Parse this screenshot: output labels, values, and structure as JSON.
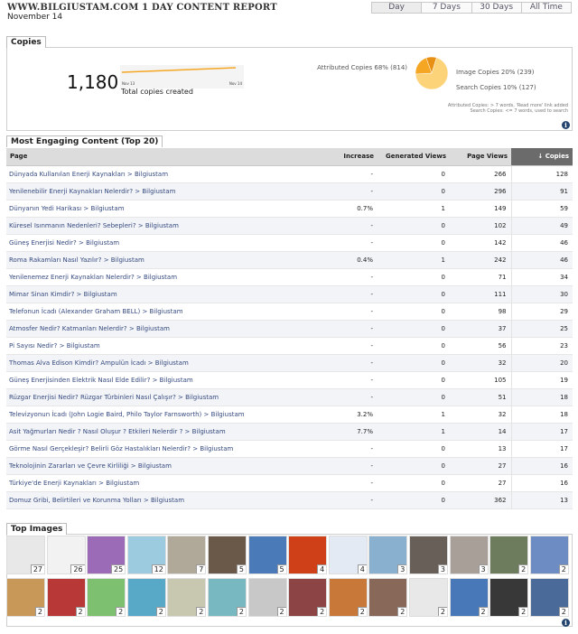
{
  "header": {
    "title": "WWW.BILGIUSTAM.COM 1 DAY CONTENT REPORT",
    "date": "November 14"
  },
  "range_tabs": [
    "Day",
    "7 Days",
    "30 Days",
    "All Time"
  ],
  "copies": {
    "section_label": "Copies",
    "total": "1,180",
    "total_label": "Total copies created",
    "spark_start": "Nov 13",
    "spark_end": "Nov 14",
    "pie": {
      "attributed_label": "Attributed Copies 68% (814)",
      "image_label": "Image Copies 20% (239)",
      "search_label": "Search Copies 10% (127)",
      "slices": [
        {
          "name": "Attributed Copies",
          "percent": 68,
          "color": "#fdd37a"
        },
        {
          "name": "Image Copies",
          "percent": 20,
          "color": "#f5a623"
        },
        {
          "name": "Search Copies",
          "percent": 10,
          "color": "#e89014"
        }
      ]
    },
    "note_line1": "Attributed Copies: > 7 words, 'Read more' link added",
    "note_line2": "Search Copies: <= 7 words, used to search"
  },
  "engaging": {
    "section_label": "Most Engaging Content (Top 20)",
    "columns": {
      "page": "Page",
      "increase": "Increase",
      "generated": "Generated Views",
      "views": "Page Views",
      "copies": "↓ Copies"
    },
    "rows": [
      {
        "page": "Dünyada Kullanılan Enerji Kaynakları > Bilgiustam",
        "increase": "-",
        "generated": "0",
        "views": "266",
        "copies": "128"
      },
      {
        "page": "Yenilenebilir Enerji Kaynakları Nelerdir? > Bilgiustam",
        "increase": "-",
        "generated": "0",
        "views": "296",
        "copies": "91"
      },
      {
        "page": "Dünyanın Yedi Harikası > Bilgiustam",
        "increase": "0.7%",
        "generated": "1",
        "views": "149",
        "copies": "59"
      },
      {
        "page": "Küresel Isınmanın Nedenleri? Sebepleri? > Bilgiustam",
        "increase": "-",
        "generated": "0",
        "views": "102",
        "copies": "49"
      },
      {
        "page": "Güneş Enerjisi Nedir? > Bilgiustam",
        "increase": "-",
        "generated": "0",
        "views": "142",
        "copies": "46"
      },
      {
        "page": "Roma Rakamları Nasıl Yazılır? > Bilgiustam",
        "increase": "0.4%",
        "generated": "1",
        "views": "242",
        "copies": "46"
      },
      {
        "page": "Yenilenemez Enerji Kaynakları Nelerdir? > Bilgiustam",
        "increase": "-",
        "generated": "0",
        "views": "71",
        "copies": "34"
      },
      {
        "page": "Mimar Sinan Kimdir? > Bilgiustam",
        "increase": "-",
        "generated": "0",
        "views": "111",
        "copies": "30"
      },
      {
        "page": "Telefonun İcadı (Alexander Graham BELL) > Bilgiustam",
        "increase": "-",
        "generated": "0",
        "views": "98",
        "copies": "29"
      },
      {
        "page": "Atmosfer Nedir? Katmanları Nelerdir? > Bilgiustam",
        "increase": "-",
        "generated": "0",
        "views": "37",
        "copies": "25"
      },
      {
        "page": "Pi Sayısı Nedir? > Bilgiustam",
        "increase": "-",
        "generated": "0",
        "views": "56",
        "copies": "23"
      },
      {
        "page": "Thomas Alva Edison Kimdir? Ampulün İcadı > Bilgiustam",
        "increase": "-",
        "generated": "0",
        "views": "32",
        "copies": "20"
      },
      {
        "page": "Güneş Enerjisinden Elektrik Nasıl Elde Edilir? > Bilgiustam",
        "increase": "-",
        "generated": "0",
        "views": "105",
        "copies": "19"
      },
      {
        "page": "Rüzgar Enerjisi Nedir? Rüzgar Türbinleri Nasıl Çalışır? > Bilgiustam",
        "increase": "-",
        "generated": "0",
        "views": "51",
        "copies": "18"
      },
      {
        "page": "Televizyonun İcadı (John Logie Baird, Philo Taylor Farnsworth) > Bilgiustam",
        "increase": "3.2%",
        "generated": "1",
        "views": "32",
        "copies": "18"
      },
      {
        "page": "Asit Yağmurları Nedir ? Nasıl Oluşur ? Etkileri Nelerdir ? > Bilgiustam",
        "increase": "7.7%",
        "generated": "1",
        "views": "14",
        "copies": "17"
      },
      {
        "page": "Görme Nasıl Gerçekleşir? Belirli Göz Hastalıkları Nelerdir? > Bilgiustam",
        "increase": "-",
        "generated": "0",
        "views": "13",
        "copies": "17"
      },
      {
        "page": "Teknolojinin Zararları ve Çevre Kirliliği > Bilgiustam",
        "increase": "-",
        "generated": "0",
        "views": "27",
        "copies": "16"
      },
      {
        "page": "Türkiye'de Enerji Kaynakları > Bilgiustam",
        "increase": "-",
        "generated": "0",
        "views": "27",
        "copies": "16"
      },
      {
        "page": "Domuz Gribi, Belirtileri ve Korunma Yolları > Bilgiustam",
        "increase": "-",
        "generated": "0",
        "views": "362",
        "copies": "13"
      }
    ]
  },
  "top_images": {
    "section_label": "Top Images",
    "images": [
      {
        "count": "27",
        "color": "#e8e8e8"
      },
      {
        "count": "26",
        "color": "#f2f2f2"
      },
      {
        "count": "25",
        "color": "#9c6bb8"
      },
      {
        "count": "12",
        "color": "#9ccbe0"
      },
      {
        "count": "7",
        "color": "#b0a898"
      },
      {
        "count": "5",
        "color": "#6a5848"
      },
      {
        "count": "5",
        "color": "#4a7bb8"
      },
      {
        "count": "4",
        "color": "#d04018"
      },
      {
        "count": "4",
        "color": "#e4eaf4"
      },
      {
        "count": "3",
        "color": "#8ab0d0"
      },
      {
        "count": "3",
        "color": "#686058"
      },
      {
        "count": "3",
        "color": "#a8a098"
      },
      {
        "count": "2",
        "color": "#6e7c5e"
      },
      {
        "count": "2",
        "color": "#6e8cc4"
      },
      {
        "count": "2",
        "color": "#c89858"
      },
      {
        "count": "2",
        "color": "#b83838"
      },
      {
        "count": "2",
        "color": "#7cc070"
      },
      {
        "count": "2",
        "color": "#58a8c8"
      },
      {
        "count": "2",
        "color": "#c8c8b0"
      },
      {
        "count": "2",
        "color": "#78b8c0"
      },
      {
        "count": "2",
        "color": "#c8c8c8"
      },
      {
        "count": "2",
        "color": "#8c4444"
      },
      {
        "count": "2",
        "color": "#c87838"
      },
      {
        "count": "2",
        "color": "#886858"
      },
      {
        "count": "2",
        "color": "#e8e8e8"
      },
      {
        "count": "2",
        "color": "#4878b8"
      },
      {
        "count": "2",
        "color": "#383838"
      },
      {
        "count": "2",
        "color": "#4a6a9a"
      }
    ]
  },
  "icons": {
    "info": "info-icon"
  }
}
